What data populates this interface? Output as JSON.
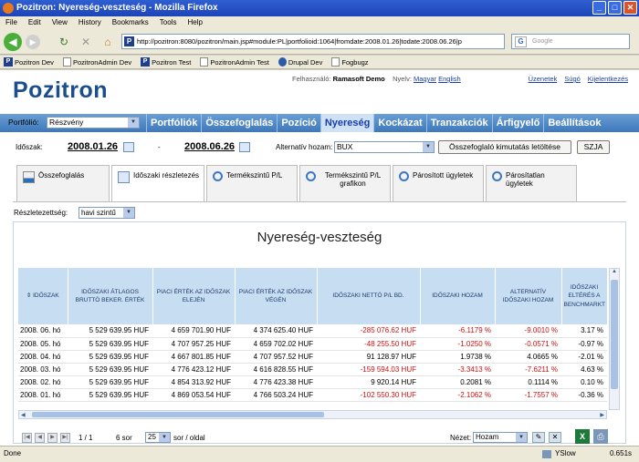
{
  "window": {
    "title": "Pozitron: Nyereség-veszteség - Mozilla Firefox"
  },
  "menu": [
    "File",
    "Edit",
    "View",
    "History",
    "Bookmarks",
    "Tools",
    "Help"
  ],
  "browser": {
    "url": "http://pozitron:8080/pozitron/main.jsp#module:PL|portfolioid:1064|fromdate:2008.01.26|todate:2008.06.26|p",
    "search_placeholder": "Google"
  },
  "bookmarks": [
    "Pozitron Dev",
    "PozitronAdmin Dev",
    "Pozitron Test",
    "PozitronAdmin Test",
    "Drupal Dev",
    "Fogbugz"
  ],
  "header": {
    "logo": "Pozitron",
    "user_label": "Felhasználó:",
    "user_name": "Ramasoft Demo",
    "lang_label": "Nyelv:",
    "lang_hu": "Magyar",
    "lang_en": "English",
    "links": [
      "Üzenetek",
      "Súgó",
      "Kijelentkezés"
    ]
  },
  "nav": {
    "portfolio_label": "Portfólió:",
    "portfolio_value": "Részvény",
    "items": [
      "Portfóliók",
      "Összefoglalás",
      "Pozíció",
      "Nyereség",
      "Kockázat",
      "Tranzakciók",
      "Árfigyelő",
      "Beállítások"
    ],
    "active": "Nyereség"
  },
  "filter": {
    "period_label": "Időszak:",
    "from_date": "2008.01.26",
    "dash": "-",
    "to_date": "2008.06.26",
    "alt_label": "Alternatív hozam:",
    "alt_value": "BUX",
    "download_button": "Összefoglaló kimutatás letöltése",
    "szja_button": "SZJA"
  },
  "tabs": [
    {
      "label": "Összefoglalás",
      "icon": "chart-icon"
    },
    {
      "label": "Időszaki részletezés",
      "icon": "calendar-icon"
    },
    {
      "label": "Termékszintű P/L",
      "icon": "magnifier-icon"
    },
    {
      "label": "Termékszintű P/L grafikon",
      "icon": "magnifier-icon"
    },
    {
      "label": "Párosított ügyletek",
      "icon": "magnifier-icon"
    },
    {
      "label": "Párosítatlan ügyletek",
      "icon": "magnifier-icon"
    }
  ],
  "detail": {
    "label": "Részletezettség:",
    "value": "havi szintű"
  },
  "report": {
    "title": "Nyereség-veszteség",
    "columns": [
      "IDŐSZAK",
      "IDŐSZAKI ÁTLAGOS BRUTTÓ BEKER. ÉRTÉK",
      "PIACI ÉRTÉK AZ IDŐSZAK ELEJÉN",
      "PIACI ÉRTÉK AZ IDŐSZAK VÉGÉN",
      "IDŐSZAKI NETTÓ P/L BD.",
      "IDŐSZAKI HOZAM",
      "ALTERNATÍV IDŐSZAKI HOZAM",
      "IDŐSZAKI ELTÉRÉS A BENCHMARKT"
    ],
    "rows": [
      {
        "cells": [
          "2008. 06. hó",
          "5 529 639.95 HUF",
          "4 659 701.90 HUF",
          "4 374 625.40 HUF",
          "-285 076.62 HUF",
          "-6.1179 %",
          "-9.0010 %",
          "3.17 %"
        ],
        "neg": [
          false,
          false,
          false,
          false,
          true,
          true,
          true,
          false
        ]
      },
      {
        "cells": [
          "2008. 05. hó",
          "5 529 639.95 HUF",
          "4 707 957.25 HUF",
          "4 659 702.02 HUF",
          "-48 255.50 HUF",
          "-1.0250 %",
          "-0.0571 %",
          "-0.97 %"
        ],
        "neg": [
          false,
          false,
          false,
          false,
          true,
          true,
          true,
          false
        ]
      },
      {
        "cells": [
          "2008. 04. hó",
          "5 529 639.95 HUF",
          "4 667 801.85 HUF",
          "4 707 957.52 HUF",
          "91 128.97 HUF",
          "1.9738 %",
          "4.0665 %",
          "-2.01 %"
        ],
        "neg": [
          false,
          false,
          false,
          false,
          false,
          false,
          false,
          false
        ]
      },
      {
        "cells": [
          "2008. 03. hó",
          "5 529 639.95 HUF",
          "4 776 423.12 HUF",
          "4 616 828.55 HUF",
          "-159 594.03 HUF",
          "-3.3413 %",
          "-7.6211 %",
          "4.63 %"
        ],
        "neg": [
          false,
          false,
          false,
          false,
          true,
          true,
          true,
          false
        ]
      },
      {
        "cells": [
          "2008. 02. hó",
          "5 529 639.95 HUF",
          "4 854 313.92 HUF",
          "4 776 423.38 HUF",
          "9 920.14 HUF",
          "0.2081 %",
          "0.1114 %",
          "0.10 %"
        ],
        "neg": [
          false,
          false,
          false,
          false,
          false,
          false,
          false,
          false
        ]
      },
      {
        "cells": [
          "2008. 01. hó",
          "5 529 639.95 HUF",
          "4 869 053.54 HUF",
          "4 766 503.24 HUF",
          "-102 550.30 HUF",
          "-2.1062 %",
          "-1.7557 %",
          "-0.36 %"
        ],
        "neg": [
          false,
          false,
          false,
          false,
          true,
          true,
          true,
          false
        ]
      }
    ]
  },
  "pager": {
    "page": "1 / 1",
    "rows_count": "6 sor",
    "page_size": "25",
    "per_page": "sor / oldal",
    "view_label": "Nézet:",
    "view_value": "Hozam"
  },
  "status": {
    "left": "Done",
    "yslow": "YSlow",
    "time": "0.651s"
  }
}
